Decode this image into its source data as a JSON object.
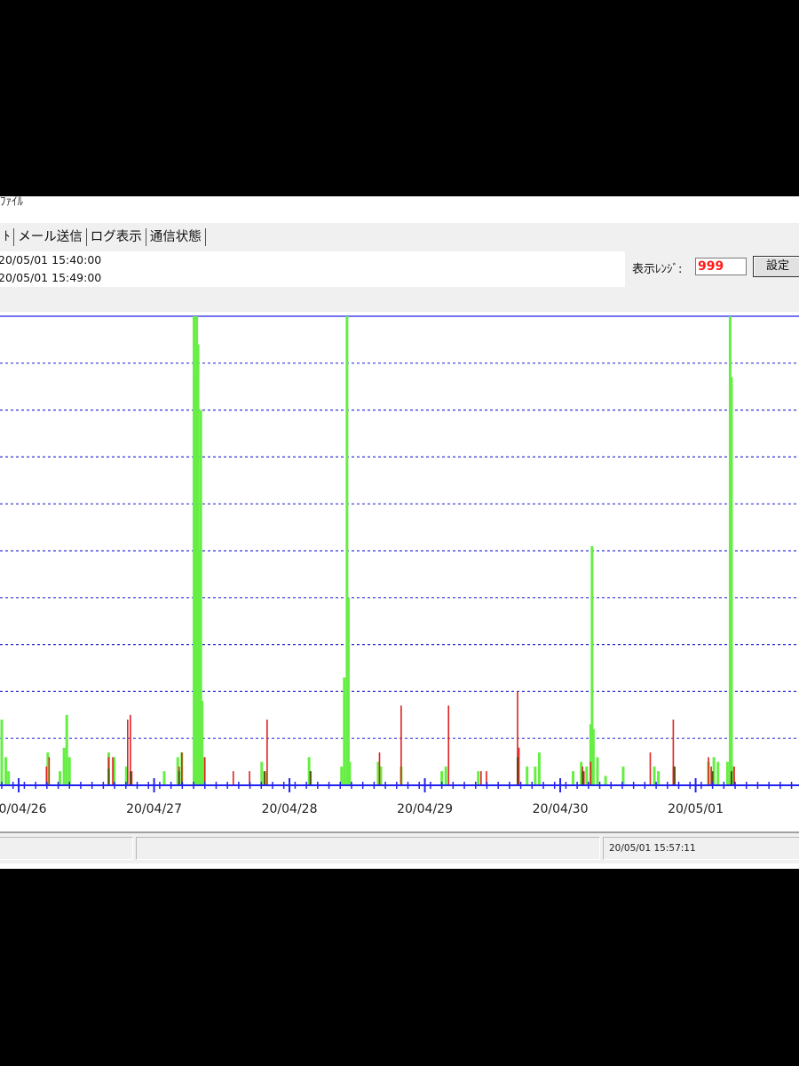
{
  "window": {
    "title_fragment": "ﾌｧｲﾙ"
  },
  "tabs": [
    {
      "label": "ﾄ"
    },
    {
      "label": "メール送信"
    },
    {
      "label": "ログ表示"
    },
    {
      "label": "通信状態"
    }
  ],
  "time_range": {
    "start": "20/05/01 15:40:00",
    "end": "20/05/01 15:49:00"
  },
  "display_range": {
    "label": "表示ﾚﾝｼﾞ:",
    "value": "999"
  },
  "buttons": {
    "set_label": "設定"
  },
  "status": {
    "timestamp": "20/05/01 15:57:11"
  },
  "colors": {
    "background": "#ffffff",
    "grid": "#3333dd",
    "axis": "#2222ee",
    "series_green": "#66ee44",
    "series_red": "#dd2222",
    "series_dark": "#5a4a10"
  },
  "chart_data": {
    "type": "bar",
    "x_unit": "days",
    "x_start": "20/04/25 21:00",
    "y_range": [
      0,
      10
    ],
    "grid": "horizontal dashed",
    "tick_labels": [
      "20/04/26",
      "20/04/27",
      "20/04/28",
      "20/04/29",
      "20/04/30",
      "20/05/01"
    ],
    "tick_positions": [
      0.125,
      1.125,
      2.125,
      3.125,
      4.125,
      5.125
    ],
    "series": [
      {
        "color": "green",
        "points": [
          [
            0.0,
            1.4
          ],
          [
            0.03,
            0.6
          ],
          [
            0.05,
            0.3
          ],
          [
            0.34,
            0.7
          ],
          [
            0.43,
            0.3
          ],
          [
            0.46,
            0.8
          ],
          [
            0.48,
            1.5
          ],
          [
            0.5,
            0.6
          ],
          [
            0.79,
            0.7
          ],
          [
            0.83,
            0.6
          ],
          [
            0.92,
            0.4
          ],
          [
            1.2,
            0.3
          ],
          [
            1.3,
            0.6
          ],
          [
            1.33,
            0.7
          ],
          [
            1.42,
            10
          ],
          [
            1.43,
            8.7
          ],
          [
            1.44,
            10
          ],
          [
            1.45,
            9.4
          ],
          [
            1.46,
            5.0
          ],
          [
            1.47,
            8.0
          ],
          [
            1.48,
            1.8
          ],
          [
            1.49,
            0.6
          ],
          [
            1.92,
            0.5
          ],
          [
            1.95,
            0.3
          ],
          [
            2.27,
            0.6
          ],
          [
            2.28,
            0.3
          ],
          [
            2.51,
            0.4
          ],
          [
            2.53,
            2.3
          ],
          [
            2.55,
            10
          ],
          [
            2.56,
            4.0
          ],
          [
            2.57,
            0.5
          ],
          [
            2.78,
            0.5
          ],
          [
            2.8,
            0.4
          ],
          [
            2.95,
            0.4
          ],
          [
            3.25,
            0.3
          ],
          [
            3.28,
            0.4
          ],
          [
            3.52,
            0.3
          ],
          [
            3.88,
            0.4
          ],
          [
            3.94,
            0.4
          ],
          [
            3.97,
            0.7
          ],
          [
            4.22,
            0.3
          ],
          [
            4.28,
            0.5
          ],
          [
            4.32,
            0.4
          ],
          [
            4.35,
            1.3
          ],
          [
            4.36,
            5.1
          ],
          [
            4.37,
            1.2
          ],
          [
            4.4,
            0.6
          ],
          [
            4.46,
            0.2
          ],
          [
            4.59,
            0.4
          ],
          [
            4.82,
            0.4
          ],
          [
            4.85,
            0.3
          ],
          [
            5.22,
            0.5
          ],
          [
            5.26,
            0.6
          ],
          [
            5.29,
            0.5
          ],
          [
            5.36,
            0.5
          ],
          [
            5.38,
            10
          ],
          [
            5.39,
            8.7
          ],
          [
            5.4,
            0.4
          ]
        ]
      },
      {
        "color": "red",
        "points": [
          [
            0.33,
            0.4
          ],
          [
            0.35,
            0.6
          ],
          [
            0.79,
            0.6
          ],
          [
            0.82,
            0.6
          ],
          [
            0.93,
            1.4
          ],
          [
            0.95,
            1.5
          ],
          [
            0.96,
            0.3
          ],
          [
            1.31,
            0.4
          ],
          [
            1.33,
            0.7
          ],
          [
            1.5,
            0.6
          ],
          [
            1.71,
            0.3
          ],
          [
            1.83,
            0.3
          ],
          [
            1.96,
            1.4
          ],
          [
            2.79,
            0.7
          ],
          [
            2.95,
            1.7
          ],
          [
            3.3,
            1.7
          ],
          [
            3.54,
            0.3
          ],
          [
            3.58,
            0.3
          ],
          [
            3.81,
            2.0
          ],
          [
            3.82,
            0.8
          ],
          [
            4.29,
            0.4
          ],
          [
            4.3,
            0.3
          ],
          [
            4.35,
            0.5
          ],
          [
            4.79,
            0.7
          ],
          [
            4.96,
            0.4
          ],
          [
            4.96,
            1.4
          ],
          [
            5.22,
            0.6
          ],
          [
            5.24,
            0.4
          ],
          [
            5.41,
            0.4
          ]
        ]
      },
      {
        "color": "dark",
        "points": [
          [
            0.79,
            0.35
          ],
          [
            0.95,
            0.3
          ],
          [
            1.31,
            0.3
          ],
          [
            1.94,
            0.3
          ],
          [
            2.28,
            0.3
          ],
          [
            3.81,
            0.6
          ],
          [
            4.29,
            0.3
          ],
          [
            4.97,
            0.4
          ],
          [
            5.25,
            0.3
          ],
          [
            5.39,
            0.3
          ]
        ]
      }
    ]
  }
}
